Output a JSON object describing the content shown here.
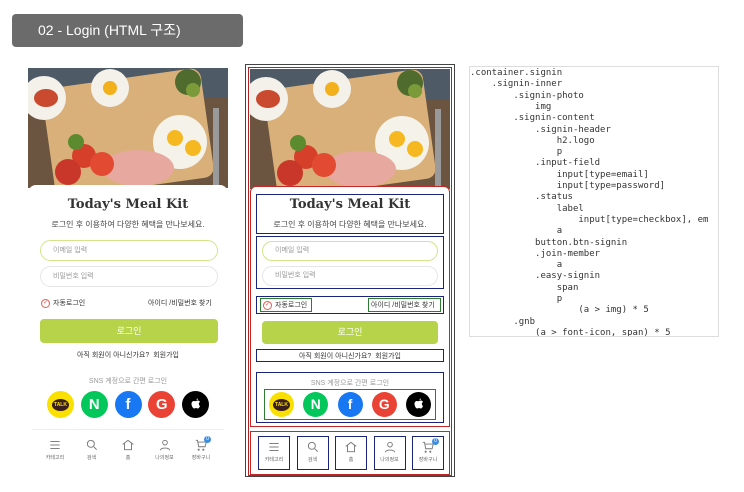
{
  "title_badge": "02 - Login (HTML 구조)",
  "mockup": {
    "logo": "Today's Meal Kit",
    "tagline": "로그인 후 이용하여 다양한 혜택을 만나보세요.",
    "email_placeholder": "이메일 입력",
    "password_placeholder": "비밀번호 입력",
    "remember_label": "자동로그인",
    "find_account_label": "아이디 /비밀번호 찾기",
    "signin_label": "로그인",
    "join_question": "아직 회원이 아니신가요?",
    "join_link": "회원가입",
    "easy_title": "SNS 계정으로 간편 로그인",
    "socials": [
      {
        "name": "kakao",
        "label": "TALK",
        "color": "#f9e000",
        "text_color": "#3b1e1e"
      },
      {
        "name": "naver",
        "label": "N",
        "color": "#03c75a",
        "text_color": "#ffffff"
      },
      {
        "name": "facebook",
        "label": "f",
        "color": "#1877f2",
        "text_color": "#ffffff"
      },
      {
        "name": "google",
        "label": "G",
        "color": "#ea4335",
        "text_color": "#ffffff"
      },
      {
        "name": "apple",
        "label": "",
        "color": "#000000",
        "text_color": "#ffffff"
      }
    ],
    "gnb": [
      {
        "icon": "menu-icon",
        "label": "카테고리"
      },
      {
        "icon": "search-icon",
        "label": "검색"
      },
      {
        "icon": "home-icon",
        "label": "홈"
      },
      {
        "icon": "user-icon",
        "label": "나의정보"
      },
      {
        "icon": "cart-icon",
        "label": "장바구니"
      }
    ],
    "cart_count": "0",
    "accent_color": "#b6d34a"
  },
  "code_lines": [
    ".container.signin",
    "    .signin-inner",
    "        .signin-photo",
    "            img",
    "        .signin-content",
    "            .signin-header",
    "                h2.logo",
    "                p",
    "            .input-field",
    "                input[type=email]",
    "                input[type=password]",
    "            .status",
    "                label",
    "                    input[type=checkbox], em",
    "                a",
    "            button.btn-signin",
    "            .join-member",
    "                a",
    "            .easy-signin",
    "                span",
    "                p",
    "                    (a > img) * 5",
    "        .gnb",
    "            (a > font-icon, span) * 5"
  ]
}
